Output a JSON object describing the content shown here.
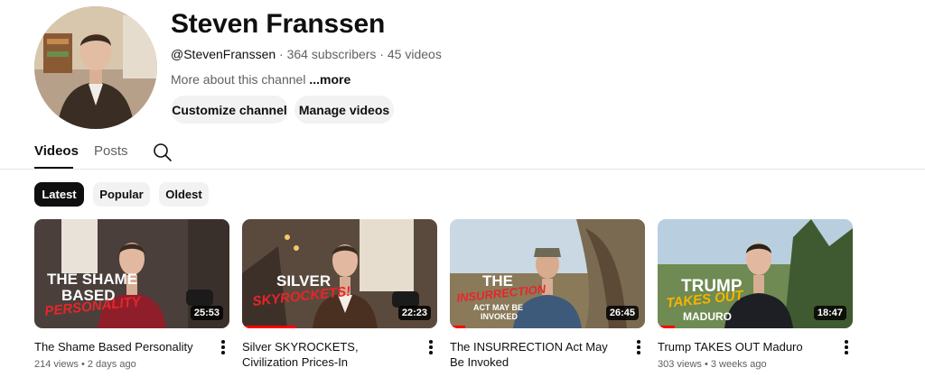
{
  "channel": {
    "name": "Steven Franssen",
    "handle": "@StevenFranssen",
    "subscribers": "364 subscribers",
    "videos_count": "45 videos",
    "about": "More about this channel",
    "more_label": "...more"
  },
  "actions": {
    "customize": "Customize channel",
    "manage": "Manage videos"
  },
  "tabs": [
    {
      "label": "Videos",
      "active": true
    },
    {
      "label": "Posts",
      "active": false
    }
  ],
  "filters": [
    {
      "label": "Latest",
      "active": true
    },
    {
      "label": "Popular",
      "active": false
    },
    {
      "label": "Oldest",
      "active": false
    }
  ],
  "videos": [
    {
      "title": "The Shame Based Personality",
      "stats": "214 views • 2 days ago",
      "duration": "25:53",
      "progress": 0,
      "thumb_lines": [
        "THE SHAME",
        "BASED",
        "PERSONALITY"
      ]
    },
    {
      "title": "Silver SKYROCKETS, Civilization Prices-In",
      "stats": "",
      "duration": "22:23",
      "progress": 0.28,
      "thumb_lines": [
        "SILVER",
        "SKYROCKETS!"
      ]
    },
    {
      "title": "The INSURRECTION Act May Be Invoked",
      "stats": "",
      "duration": "26:45",
      "progress": 0.08,
      "thumb_lines": [
        "THE",
        "INSURRECTION",
        "ACT MAY BE",
        "INVOKED"
      ]
    },
    {
      "title": "Trump TAKES OUT Maduro",
      "stats": "303 views • 3 weeks ago",
      "duration": "18:47",
      "progress": 0.09,
      "thumb_lines": [
        "TRUMP",
        "TAKES OUT",
        "MADURO"
      ]
    }
  ],
  "colors": {
    "accent_red": "#ff0000",
    "thumb_highlight": "#e8252a",
    "thumb_gold": "#f4b400"
  },
  "icons": [
    "search-icon",
    "kebab-menu-icon"
  ]
}
